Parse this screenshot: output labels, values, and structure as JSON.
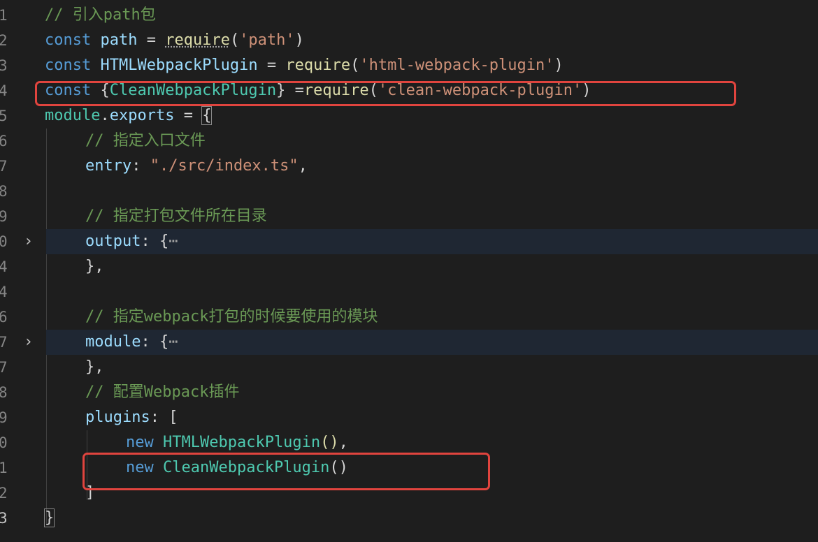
{
  "accent_colors": {
    "keyword": "#569cd6",
    "variable": "#9cdcfe",
    "class": "#4ec9b0",
    "function": "#dcdcaa",
    "string": "#ce9178",
    "comment": "#6a9955",
    "highlight_box": "#e0443e"
  },
  "lines": [
    {
      "num": "1",
      "comment": "// 引入path包"
    },
    {
      "num": "2",
      "kw": "const",
      "name": "path",
      "op": " = ",
      "fn": "require",
      "open": "(",
      "str": "'path'",
      "close": ")"
    },
    {
      "num": "3",
      "kw": "const",
      "name": "HTMLWebpackPlugin",
      "op": " = ",
      "fn": "require",
      "open": "(",
      "str": "'html-webpack-plugin'",
      "close": ")"
    },
    {
      "num": "4",
      "kw": "const",
      "lb": "{",
      "name": "CleanWebpackPlugin",
      "rb": "}",
      "op": " =",
      "fn": "require",
      "open": "(",
      "str": "'clean-webpack-plugin'",
      "close": ")"
    },
    {
      "num": "5",
      "obj": "module",
      "dot": ".",
      "prop": "exports",
      "op": " = ",
      "brace": "{"
    },
    {
      "num": "6",
      "comment": "// 指定入口文件"
    },
    {
      "num": "7",
      "prop": "entry",
      "colon": ": ",
      "str": "\"./src/index.ts\"",
      "comma": ","
    },
    {
      "num": "8"
    },
    {
      "num": "9",
      "comment": "// 指定打包文件所在目录"
    },
    {
      "num": "0",
      "prop": "output",
      "colon": ": ",
      "brace": "{",
      "ellipsis": "⋯"
    },
    {
      "num": "4",
      "close": "}",
      "comma": ","
    },
    {
      "num": "4"
    },
    {
      "num": "6",
      "comment": "// 指定webpack打包的时候要使用的模块"
    },
    {
      "num": "7",
      "prop": "module",
      "colon": ": ",
      "brace": "{",
      "ellipsis": "⋯"
    },
    {
      "num": "7",
      "close": "}",
      "comma": ","
    },
    {
      "num": "8",
      "comment": "// 配置Webpack插件"
    },
    {
      "num": "9",
      "prop": "plugins",
      "colon": ": ",
      "bracket": "["
    },
    {
      "num": "0",
      "kw": "new",
      "cls": "HTMLWebpackPlugin",
      "call": "()",
      "comma": ","
    },
    {
      "num": "1",
      "kw": "new",
      "cls": "CleanWebpackPlugin",
      "call": "()"
    },
    {
      "num": "2",
      "bracket": "]"
    },
    {
      "num": "3",
      "brace": "}"
    }
  ],
  "fold_icons": [
    "chevron-right-icon",
    "chevron-right-icon"
  ]
}
